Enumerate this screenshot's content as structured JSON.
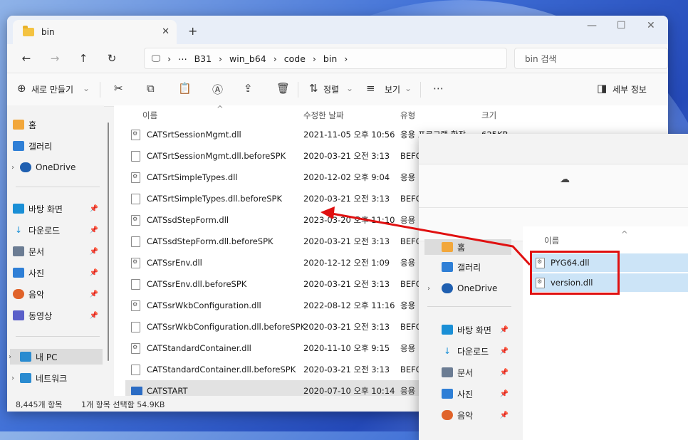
{
  "explorer1": {
    "tab_title": "bin",
    "breadcrumb": [
      "B31",
      "win_b64",
      "code",
      "bin"
    ],
    "search_placeholder": "bin 검색",
    "toolbar": {
      "new_label": "새로 만들기",
      "sort_label": "정렬",
      "view_label": "보기",
      "details_label": "세부 정보"
    },
    "sidebar": {
      "home": "홈",
      "gallery": "갤러리",
      "onedrive": "OneDrive",
      "desktop": "바탕 화면",
      "downloads": "다운로드",
      "documents": "문서",
      "pictures": "사진",
      "music": "음악",
      "videos": "동영상",
      "thispc": "내 PC",
      "network": "네트워크"
    },
    "columns": {
      "name": "이름",
      "modified": "수정한 날짜",
      "type": "유형",
      "size": "크기"
    },
    "files": [
      {
        "name": "CATSrtSessionMgmt.dll",
        "date": "2021-11-05 오후 10:56",
        "type": "응용 프로그램 확장",
        "size": "625KB"
      },
      {
        "name": "CATSrtSessionMgmt.dll.beforeSPK",
        "date": "2020-03-21 오전 3:13",
        "type": "BEFO",
        "size": ""
      },
      {
        "name": "CATSrtSimpleTypes.dll",
        "date": "2020-12-02 오후 9:04",
        "type": "응용",
        "size": ""
      },
      {
        "name": "CATSrtSimpleTypes.dll.beforeSPK",
        "date": "2020-03-21 오전 3:13",
        "type": "BEFO",
        "size": ""
      },
      {
        "name": "CATSsdStepForm.dll",
        "date": "2023-03-20 오후 11:10",
        "type": "응용",
        "size": ""
      },
      {
        "name": "CATSsdStepForm.dll.beforeSPK",
        "date": "2020-03-21 오전 3:13",
        "type": "BEFO",
        "size": ""
      },
      {
        "name": "CATSsrEnv.dll",
        "date": "2020-12-12 오전 1:09",
        "type": "응용",
        "size": ""
      },
      {
        "name": "CATSsrEnv.dll.beforeSPK",
        "date": "2020-03-21 오전 3:13",
        "type": "BEFO",
        "size": ""
      },
      {
        "name": "CATSsrWkbConfiguration.dll",
        "date": "2022-08-12 오후 11:16",
        "type": "응용",
        "size": ""
      },
      {
        "name": "CATSsrWkbConfiguration.dll.beforeSPK",
        "date": "2020-03-21 오전 3:13",
        "type": "BEFO",
        "size": ""
      },
      {
        "name": "CATStandardContainer.dll",
        "date": "2020-11-10 오후 9:15",
        "type": "응용",
        "size": ""
      },
      {
        "name": "CATStandardContainer.dll.beforeSPK",
        "date": "2020-03-21 오전 3:13",
        "type": "BEFO",
        "size": ""
      },
      {
        "name": "CATSTART",
        "date": "2020-07-10 오후 10:14",
        "type": "응용",
        "size": ""
      }
    ],
    "status": {
      "count": "8,445개 항목",
      "selected": "1개 항목 선택함 54.9KB"
    }
  },
  "explorer2": {
    "sidebar": {
      "home": "홈",
      "gallery": "갤러리",
      "onedrive": "OneDrive",
      "desktop": "바탕 화면",
      "downloads": "다운로드",
      "documents": "문서",
      "pictures": "사진",
      "music": "음악"
    },
    "column_name": "이름",
    "files": [
      "PYG64.dll",
      "version.dll"
    ]
  },
  "annotation_color": "#e01010"
}
